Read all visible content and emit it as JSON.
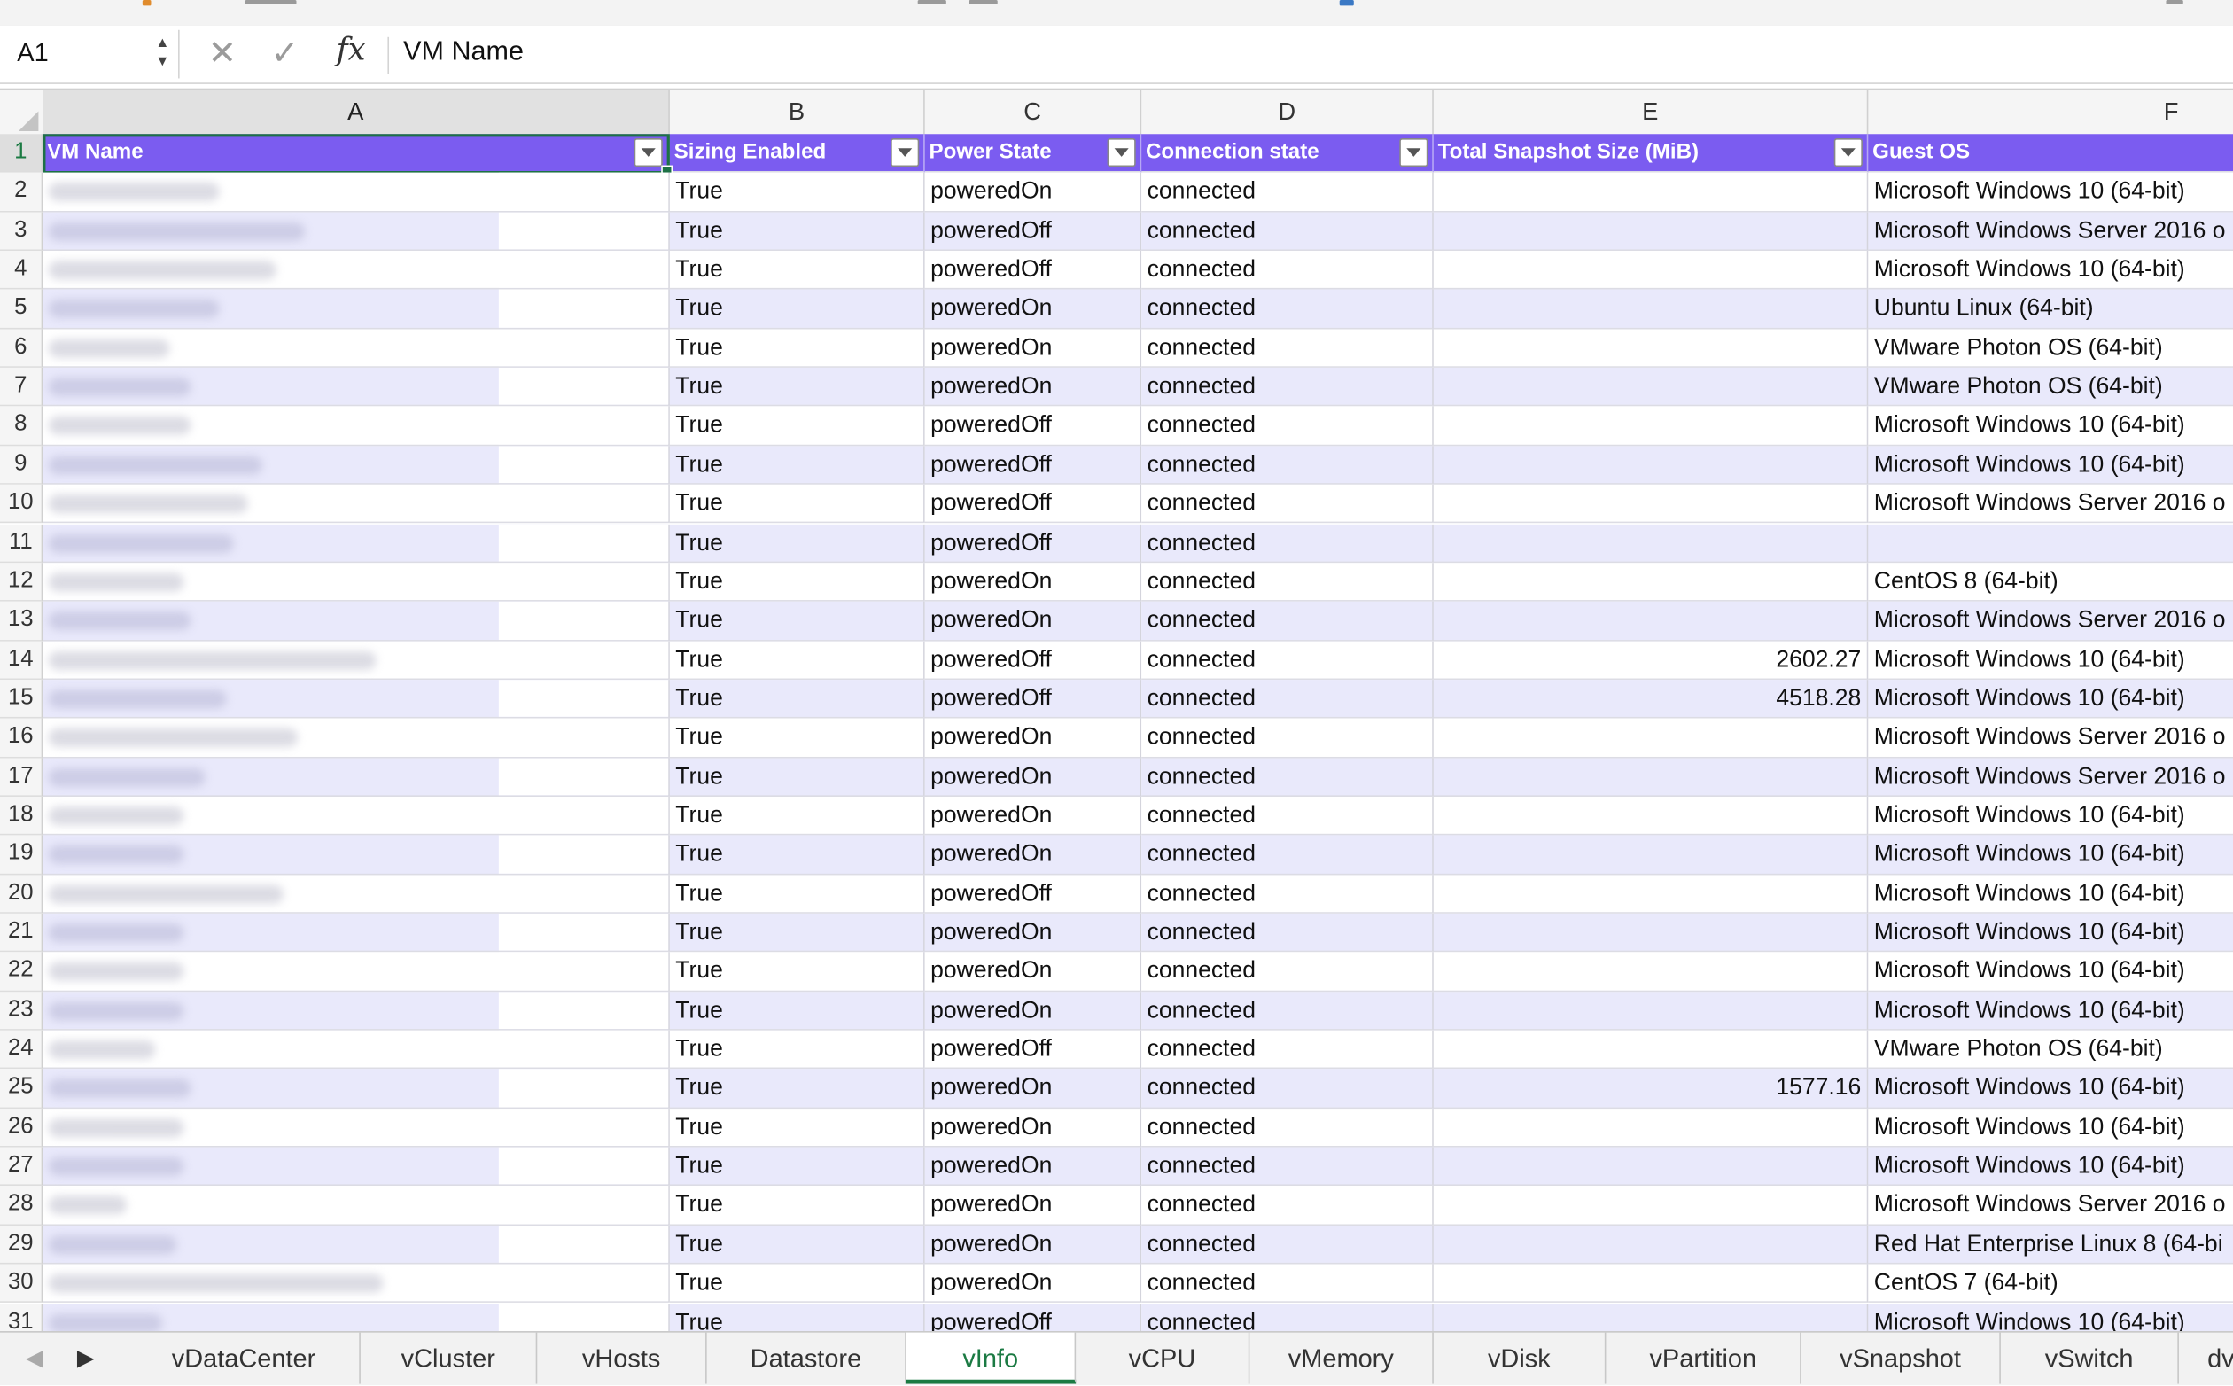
{
  "formula_bar": {
    "cell_ref": "A1",
    "cancel_icon": "✕",
    "enter_icon": "✓",
    "fx_label": "fx",
    "content": "VM Name"
  },
  "columns": [
    "A",
    "B",
    "C",
    "D",
    "E",
    "F"
  ],
  "headers": [
    "VM Name",
    "Sizing Enabled",
    "Power State",
    "Connection state",
    "Total Snapshot Size (MiB)",
    "Guest OS"
  ],
  "rows": [
    {
      "n": "2",
      "b": "True",
      "c": "poweredOn",
      "d": "connected",
      "e": "",
      "f": "Microsoft Windows 10 (64-bit)"
    },
    {
      "n": "3",
      "b": "True",
      "c": "poweredOff",
      "d": "connected",
      "e": "",
      "f": "Microsoft Windows Server 2016 o"
    },
    {
      "n": "4",
      "b": "True",
      "c": "poweredOff",
      "d": "connected",
      "e": "",
      "f": "Microsoft Windows 10 (64-bit)"
    },
    {
      "n": "5",
      "b": "True",
      "c": "poweredOn",
      "d": "connected",
      "e": "",
      "f": "Ubuntu Linux (64-bit)"
    },
    {
      "n": "6",
      "b": "True",
      "c": "poweredOn",
      "d": "connected",
      "e": "",
      "f": "VMware Photon OS (64-bit)"
    },
    {
      "n": "7",
      "b": "True",
      "c": "poweredOn",
      "d": "connected",
      "e": "",
      "f": "VMware Photon OS (64-bit)"
    },
    {
      "n": "8",
      "b": "True",
      "c": "poweredOff",
      "d": "connected",
      "e": "",
      "f": "Microsoft Windows 10 (64-bit)"
    },
    {
      "n": "9",
      "b": "True",
      "c": "poweredOff",
      "d": "connected",
      "e": "",
      "f": "Microsoft Windows 10 (64-bit)"
    },
    {
      "n": "10",
      "b": "True",
      "c": "poweredOff",
      "d": "connected",
      "e": "",
      "f": "Microsoft Windows Server 2016 o"
    },
    {
      "n": "11",
      "b": "True",
      "c": "poweredOff",
      "d": "connected",
      "e": "",
      "f": ""
    },
    {
      "n": "12",
      "b": "True",
      "c": "poweredOn",
      "d": "connected",
      "e": "",
      "f": "CentOS 8 (64-bit)"
    },
    {
      "n": "13",
      "b": "True",
      "c": "poweredOn",
      "d": "connected",
      "e": "",
      "f": "Microsoft Windows Server 2016 o"
    },
    {
      "n": "14",
      "b": "True",
      "c": "poweredOff",
      "d": "connected",
      "e": "2602.27",
      "f": "Microsoft Windows 10 (64-bit)"
    },
    {
      "n": "15",
      "b": "True",
      "c": "poweredOff",
      "d": "connected",
      "e": "4518.28",
      "f": "Microsoft Windows 10 (64-bit)"
    },
    {
      "n": "16",
      "b": "True",
      "c": "poweredOn",
      "d": "connected",
      "e": "",
      "f": "Microsoft Windows Server 2016 o"
    },
    {
      "n": "17",
      "b": "True",
      "c": "poweredOn",
      "d": "connected",
      "e": "",
      "f": "Microsoft Windows Server 2016 o"
    },
    {
      "n": "18",
      "b": "True",
      "c": "poweredOn",
      "d": "connected",
      "e": "",
      "f": "Microsoft Windows 10 (64-bit)"
    },
    {
      "n": "19",
      "b": "True",
      "c": "poweredOn",
      "d": "connected",
      "e": "",
      "f": "Microsoft Windows 10 (64-bit)"
    },
    {
      "n": "20",
      "b": "True",
      "c": "poweredOff",
      "d": "connected",
      "e": "",
      "f": "Microsoft Windows 10 (64-bit)"
    },
    {
      "n": "21",
      "b": "True",
      "c": "poweredOn",
      "d": "connected",
      "e": "",
      "f": "Microsoft Windows 10 (64-bit)"
    },
    {
      "n": "22",
      "b": "True",
      "c": "poweredOn",
      "d": "connected",
      "e": "",
      "f": "Microsoft Windows 10 (64-bit)"
    },
    {
      "n": "23",
      "b": "True",
      "c": "poweredOn",
      "d": "connected",
      "e": "",
      "f": "Microsoft Windows 10 (64-bit)"
    },
    {
      "n": "24",
      "b": "True",
      "c": "poweredOff",
      "d": "connected",
      "e": "",
      "f": "VMware Photon OS (64-bit)"
    },
    {
      "n": "25",
      "b": "True",
      "c": "poweredOn",
      "d": "connected",
      "e": "1577.16",
      "f": "Microsoft Windows 10 (64-bit)"
    },
    {
      "n": "26",
      "b": "True",
      "c": "poweredOn",
      "d": "connected",
      "e": "",
      "f": "Microsoft Windows 10 (64-bit)"
    },
    {
      "n": "27",
      "b": "True",
      "c": "poweredOn",
      "d": "connected",
      "e": "",
      "f": "Microsoft Windows 10 (64-bit)"
    },
    {
      "n": "28",
      "b": "True",
      "c": "poweredOn",
      "d": "connected",
      "e": "",
      "f": "Microsoft Windows Server 2016 o"
    },
    {
      "n": "29",
      "b": "True",
      "c": "poweredOn",
      "d": "connected",
      "e": "",
      "f": "Red Hat Enterprise Linux 8 (64-bi"
    },
    {
      "n": "30",
      "b": "True",
      "c": "poweredOn",
      "d": "connected",
      "e": "",
      "f": "CentOS 7 (64-bit)"
    },
    {
      "n": "31",
      "b": "True",
      "c": "poweredOff",
      "d": "connected",
      "e": "",
      "f": "Microsoft Windows 10 (64-bit)"
    }
  ],
  "sheet_tabs": [
    "vDataCenter",
    "vCluster",
    "vHosts",
    "Datastore",
    "vInfo",
    "vCPU",
    "vMemory",
    "vDisk",
    "vPartition",
    "vSnapshot",
    "vSwitch",
    "dv"
  ],
  "active_tab": "vInfo",
  "nav_icons": {
    "prev": "◀",
    "next": "▶"
  },
  "colors": {
    "header_bg": "#7b5cf0",
    "band": "#e9e9fb",
    "selection": "#1e7145",
    "active_tab": "#1b7a43"
  }
}
